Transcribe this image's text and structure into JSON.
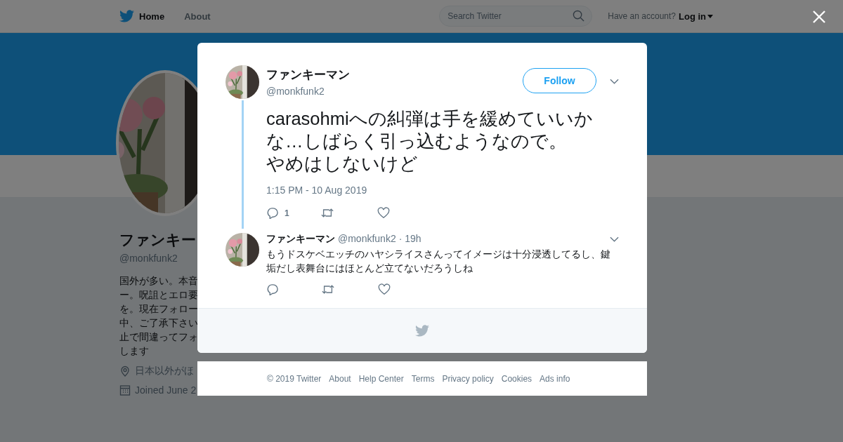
{
  "top_bar": {
    "nav": [
      "Home",
      "About"
    ],
    "search": {
      "placeholder": "Search Twitter"
    },
    "account_prompt": "Have an account?",
    "login": "Log in"
  },
  "profile": {
    "name": "ファンキー",
    "handle": "@monkfunk2",
    "bio_lines": [
      "国外が多い。本音",
      "ー。呪詛とエロ要",
      "を。現在フォロー",
      "中、ご了承下さい",
      "止で間違ってフォ",
      "します"
    ],
    "location": "日本以外がほ",
    "joined": "Joined June 2"
  },
  "tweet": {
    "author": "ファンキーマン",
    "handle": "@monkfunk2",
    "follow": "Follow",
    "text_lines": [
      "carasohmiへの糾弾は手を緩めていいかな…しばらく引っ込むようなので。",
      "やめはしないけど"
    ],
    "time": "1:15 PM - 10 Aug 2019",
    "reply_count": "1"
  },
  "replies": [
    {
      "author": "ファンキーマン",
      "handle": "@monkfunk2",
      "age": "· 19h",
      "text": "もうドスケベエッチのハヤシライスさんってイメージは十分浸透してるし、鍵垢だし表舞台にはほとんど立てないだろうしね"
    }
  ],
  "footer_links": [
    "© 2019 Twitter",
    "About",
    "Help Center",
    "Terms",
    "Privacy policy",
    "Cookies",
    "Ads info"
  ]
}
